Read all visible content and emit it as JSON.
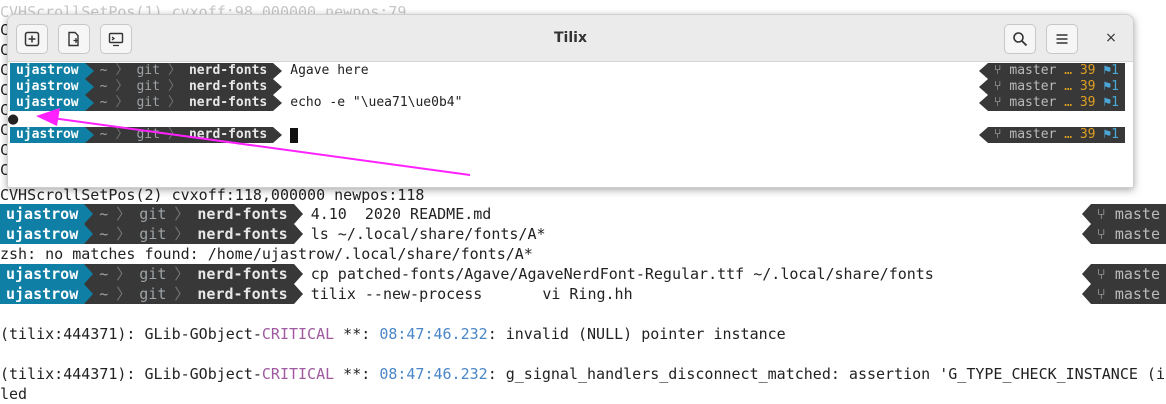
{
  "background_terminal": {
    "ghost_lines": [
      "CVHScrollSetPos(1) cvxoff:98,000000 newpos:79"
    ],
    "left_edge_chars": [
      "C",
      "C",
      "C",
      "C",
      "C",
      "C",
      "C",
      "C",
      "C",
      "C"
    ],
    "scroll_line": "CVHScrollSetPos(2) cvxoff:118,000000 newpos:118",
    "ghost_readme": "4.10  2020 README.md",
    "prompt": {
      "user": "ujastrow",
      "tilde": "~",
      "git": "git",
      "repo": "nerd-fonts"
    },
    "commands": [
      "",
      "ls ~/.local/share/fonts/A*",
      "cp patched-fonts/Agave/AgaveNerdFont-Regular.ttf ~/.local/share/fonts",
      "tilix --new-process"
    ],
    "zsh_error": "zsh: no matches found: /home/ujastrow/.local/share/fonts/A*",
    "ghost_ring": "vi Ring.hh",
    "right_prompt_label": "maste",
    "critical_1": {
      "prefix": "(tilix:444371): GLib-GObject-",
      "level": "CRITICAL",
      "mid": " **: ",
      "time": "08:47:46.232",
      "msg": ": invalid (NULL) pointer instance"
    },
    "critical_2": {
      "prefix": "(tilix:444371): GLib-GObject-",
      "level": "CRITICAL",
      "mid": " **: ",
      "time": "08:47:46.232",
      "msg": ": g_signal_handlers_disconnect_matched: assertion 'G_TYPE_CHECK_INSTANCE (in"
    },
    "last_line": "led"
  },
  "tilix_window": {
    "title": "Tilix",
    "buttons": {
      "add_terminal": "add-terminal",
      "add_session": "add-session",
      "sync_input": "sync-input",
      "search": "search",
      "menu": "menu",
      "close": "×"
    },
    "prompt": {
      "user": "ujastrow",
      "tilde": "~",
      "git": "git",
      "repo": "nerd-fonts"
    },
    "lines": [
      {
        "cmd": "Agave here"
      },
      {
        "cmd": ""
      },
      {
        "cmd": "echo -e \"\\uea71\\ue0b4\""
      }
    ],
    "output_glyph": "●",
    "right_prompt": {
      "branch_icon": "⑂",
      "branch": "master",
      "ahead": "… 39",
      "flag": "⚑",
      "flag_count": "1"
    }
  },
  "colors": {
    "user_bg": "#0f7fa5",
    "segment_bg": "#383838",
    "arrow": "#ff22ff",
    "critical": "#a05aa0",
    "timestamp": "#4a86c8"
  }
}
